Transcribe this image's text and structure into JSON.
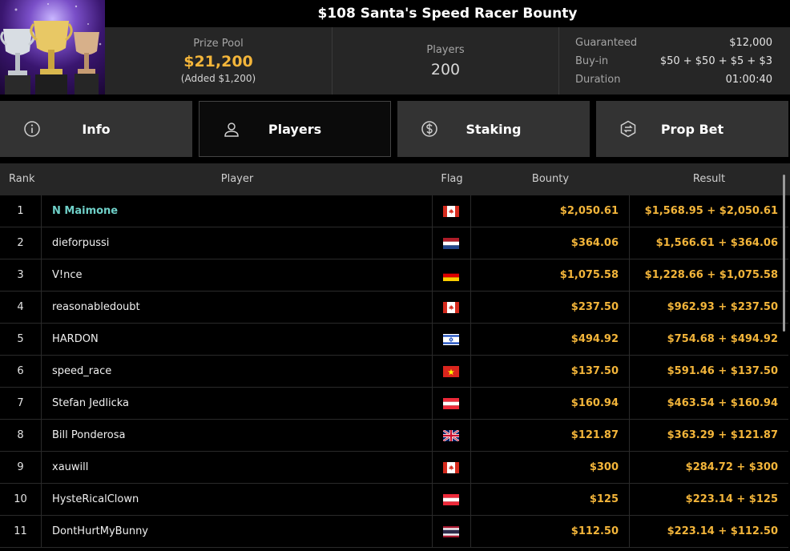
{
  "header": {
    "title": "$108 Santa's Speed Racer Bounty",
    "prize_pool": {
      "label": "Prize Pool",
      "amount": "$21,200",
      "added": "(Added $1,200)"
    },
    "players": {
      "label": "Players",
      "count": "200"
    },
    "details": [
      {
        "key": "Guaranteed",
        "value": "$12,000"
      },
      {
        "key": "Buy-in",
        "value": "$50 + $50 + $5 + $3"
      },
      {
        "key": "Duration",
        "value": "01:00:40"
      }
    ]
  },
  "tabs": [
    {
      "label": "Info",
      "icon": "info-icon",
      "active": false
    },
    {
      "label": "Players",
      "icon": "user-icon",
      "active": true
    },
    {
      "label": "Staking",
      "icon": "dollar-coin-icon",
      "active": false
    },
    {
      "label": "Prop Bet",
      "icon": "prop-bet-icon",
      "active": false
    }
  ],
  "table": {
    "headers": {
      "rank": "Rank",
      "player": "Player",
      "flag": "Flag",
      "bounty": "Bounty",
      "result": "Result"
    },
    "rows": [
      {
        "rank": "1",
        "player": "N Maimone",
        "flag": "canada",
        "bounty": "$2,050.61",
        "result": "$1,568.95 + $2,050.61"
      },
      {
        "rank": "2",
        "player": "dieforpussi",
        "flag": "netherlands",
        "bounty": "$364.06",
        "result": "$1,566.61 + $364.06"
      },
      {
        "rank": "3",
        "player": "V!nce",
        "flag": "germany",
        "bounty": "$1,075.58",
        "result": "$1,228.66 + $1,075.58"
      },
      {
        "rank": "4",
        "player": "reasonabledoubt",
        "flag": "canada",
        "bounty": "$237.50",
        "result": "$962.93 + $237.50"
      },
      {
        "rank": "5",
        "player": "HARDON",
        "flag": "israel",
        "bounty": "$494.92",
        "result": "$754.68 + $494.92"
      },
      {
        "rank": "6",
        "player": "speed_race",
        "flag": "vietnam",
        "bounty": "$137.50",
        "result": "$591.46 + $137.50"
      },
      {
        "rank": "7",
        "player": "Stefan Jedlicka",
        "flag": "austria",
        "bounty": "$160.94",
        "result": "$463.54 + $160.94"
      },
      {
        "rank": "8",
        "player": "Bill Ponderosa",
        "flag": "uk",
        "bounty": "$121.87",
        "result": "$363.29 + $121.87"
      },
      {
        "rank": "9",
        "player": "xauwill",
        "flag": "canada",
        "bounty": "$300",
        "result": "$284.72 + $300"
      },
      {
        "rank": "10",
        "player": "HysteRicalClown",
        "flag": "austria",
        "bounty": "$125",
        "result": "$223.14 + $125"
      },
      {
        "rank": "11",
        "player": "DontHurtMyBunny",
        "flag": "thailand",
        "bounty": "$112.50",
        "result": "$223.14 + $112.50"
      }
    ]
  }
}
